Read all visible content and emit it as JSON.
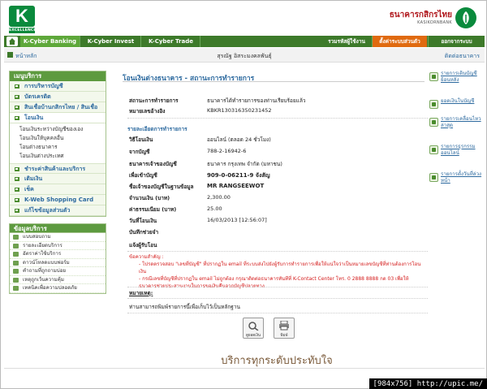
{
  "header": {
    "logo_letter": "K",
    "logo_tag": "EXCELLENCE",
    "bank_name_th": "ธนาคารกสิกรไทย",
    "bank_name_en": "KASIKORNBANK"
  },
  "nav": {
    "tabs": [
      "K-Cyber Banking",
      "K-Cyber Invest",
      "K-Cyber Trade"
    ],
    "right": [
      "รวมรหัสผู้ใช้งาน",
      "ตั้งค่าระบบส่วนตัว",
      "ออกจากระบบ"
    ]
  },
  "subbar": {
    "home": "หน้าหลัก",
    "user": "สุรณัฐ อิสระมงคลพันธุ์",
    "contact": "ติดต่อธนาคาร"
  },
  "sidebar": {
    "menu_title": "เมนูบริการ",
    "items": [
      {
        "label": "การบริหารบัญชี"
      },
      {
        "label": "บัตรเครดิต"
      },
      {
        "label": "สินเชื่อบ้านกสิกรไทย / สินเชื่ออื่นๆ"
      },
      {
        "label": "โอนเงิน"
      }
    ],
    "transfer_sub": [
      "โอนเงินระหว่างบัญชีของเอง",
      "โอนเงินให้บุคคลอื่น",
      "โอนต่างธนาคาร",
      "โอนเงินต่างประเทศ"
    ],
    "items2": [
      {
        "label": "ชำระค่าสินค้าและบริการ"
      },
      {
        "label": "เติมเงิน"
      },
      {
        "label": "เช็ค"
      },
      {
        "label": "K-Web Shopping Card"
      },
      {
        "label": "แก้ไขข้อมูลส่วนตัว"
      }
    ],
    "info_title": "ข้อมูลบริการ",
    "info_items": [
      "แบบสอบถาม",
      "รายละเอียดบริการ",
      "อัตราค่าใช้บริการ",
      "ดาวน์โหลดแบบฟอร์ม",
      "คำถามที่ถูกถามบ่อย",
      "เหตุถูกเว้นความคุ้ม",
      "เทคนิคเพื่อความปลอดภัย"
    ]
  },
  "main": {
    "title": "โอนเงินต่างธนาคาร - สถานะการทำรายการ",
    "status_label": "สถานะการทำรายการ",
    "status_value": "ธนาคารได้ทำรายการของท่านเรียบร้อยแล้ว",
    "ref_label": "หมายเลขอ้างอิง",
    "ref_value": "KBKR130316350231452",
    "detail_title": "รายละเอียดการทำรายการ",
    "rows": [
      {
        "label": "วิธีโอนเงิน",
        "value": "ออนไลน์ (ตลอด 24 ชั่วโมง)",
        "bold": false
      },
      {
        "label": "จากบัญชี",
        "value": "788-2-16942-6",
        "bold": false
      },
      {
        "label": "ธนาคารเจ้าของบัญชี",
        "value": "ธนาคาร กรุงเทพ จำกัด (มหาชน)",
        "bold": false
      },
      {
        "label": "เพื่อเข้าบัญชี",
        "value": "909-0-06211-9 จังสัญ",
        "bold": true
      },
      {
        "label": "ชื่อเจ้าของบัญชีในฐานข้อมูล",
        "value": "MR RANGSEEWOT",
        "bold": true
      },
      {
        "label": "จำนวนเงิน (บาท)",
        "value": "2,300.00",
        "bold": false
      },
      {
        "label": "ค่าธรรมเนียม (บาท)",
        "value": "25.00",
        "bold": false
      },
      {
        "label": "วันที่โอนเงิน",
        "value": "16/03/2013 [12:56:07]",
        "bold": false
      },
      {
        "label": "บันทึกช่วยจำ",
        "value": "",
        "bold": false
      },
      {
        "label": "แจ้งผู้รับโอน",
        "value": "",
        "bold": false
      }
    ],
    "warn_title": "ข้อความสำคัญ :",
    "warn_1": "- โปรดตรวจสอบ \"เลขที่บัญชี\" ที่ปรากฏใน email ที่ระบบส่งไปยังผู้รับการทำรายการเพื่อให้แน่ใจว่าเป็นหมายเลขบัญชีที่ท่านต้องการโอนเงิน",
    "warn_2": "- กรณีเลขที่บัญชีที่ปรากฏใน email ไม่ถูกต้อง กรุณาติดต่อธนาคารทันทีที่ K-Contact Center โทร. 0 2888 8888 กด 03 เพื่อให้ธนาคารช่วยประสานงานในการขอเงินคืนจากบัญชีปลายทาง",
    "note_title": "หมายเหตุ:",
    "note": "ท่านสามารถพิมพ์รายการนี้เพื่อเก็บไว้เป็นหลักฐาน",
    "btn_view": "ดูยอดเงิน",
    "btn_print": "พิมพ์"
  },
  "right": {
    "items": [
      "รายการเดินบัญชีย้อนหลัง",
      "ยอดเงินในบัญชี",
      "รายการเคลื่อนไหวล่าสุด",
      "รายการธุรกรรมออนไลน์",
      "รายการตั้งวันที่ล่วงหน้า"
    ]
  },
  "slogan": "บริการทุกระดับประทับใจ",
  "watermark": "[984x756] http://upic.me/"
}
